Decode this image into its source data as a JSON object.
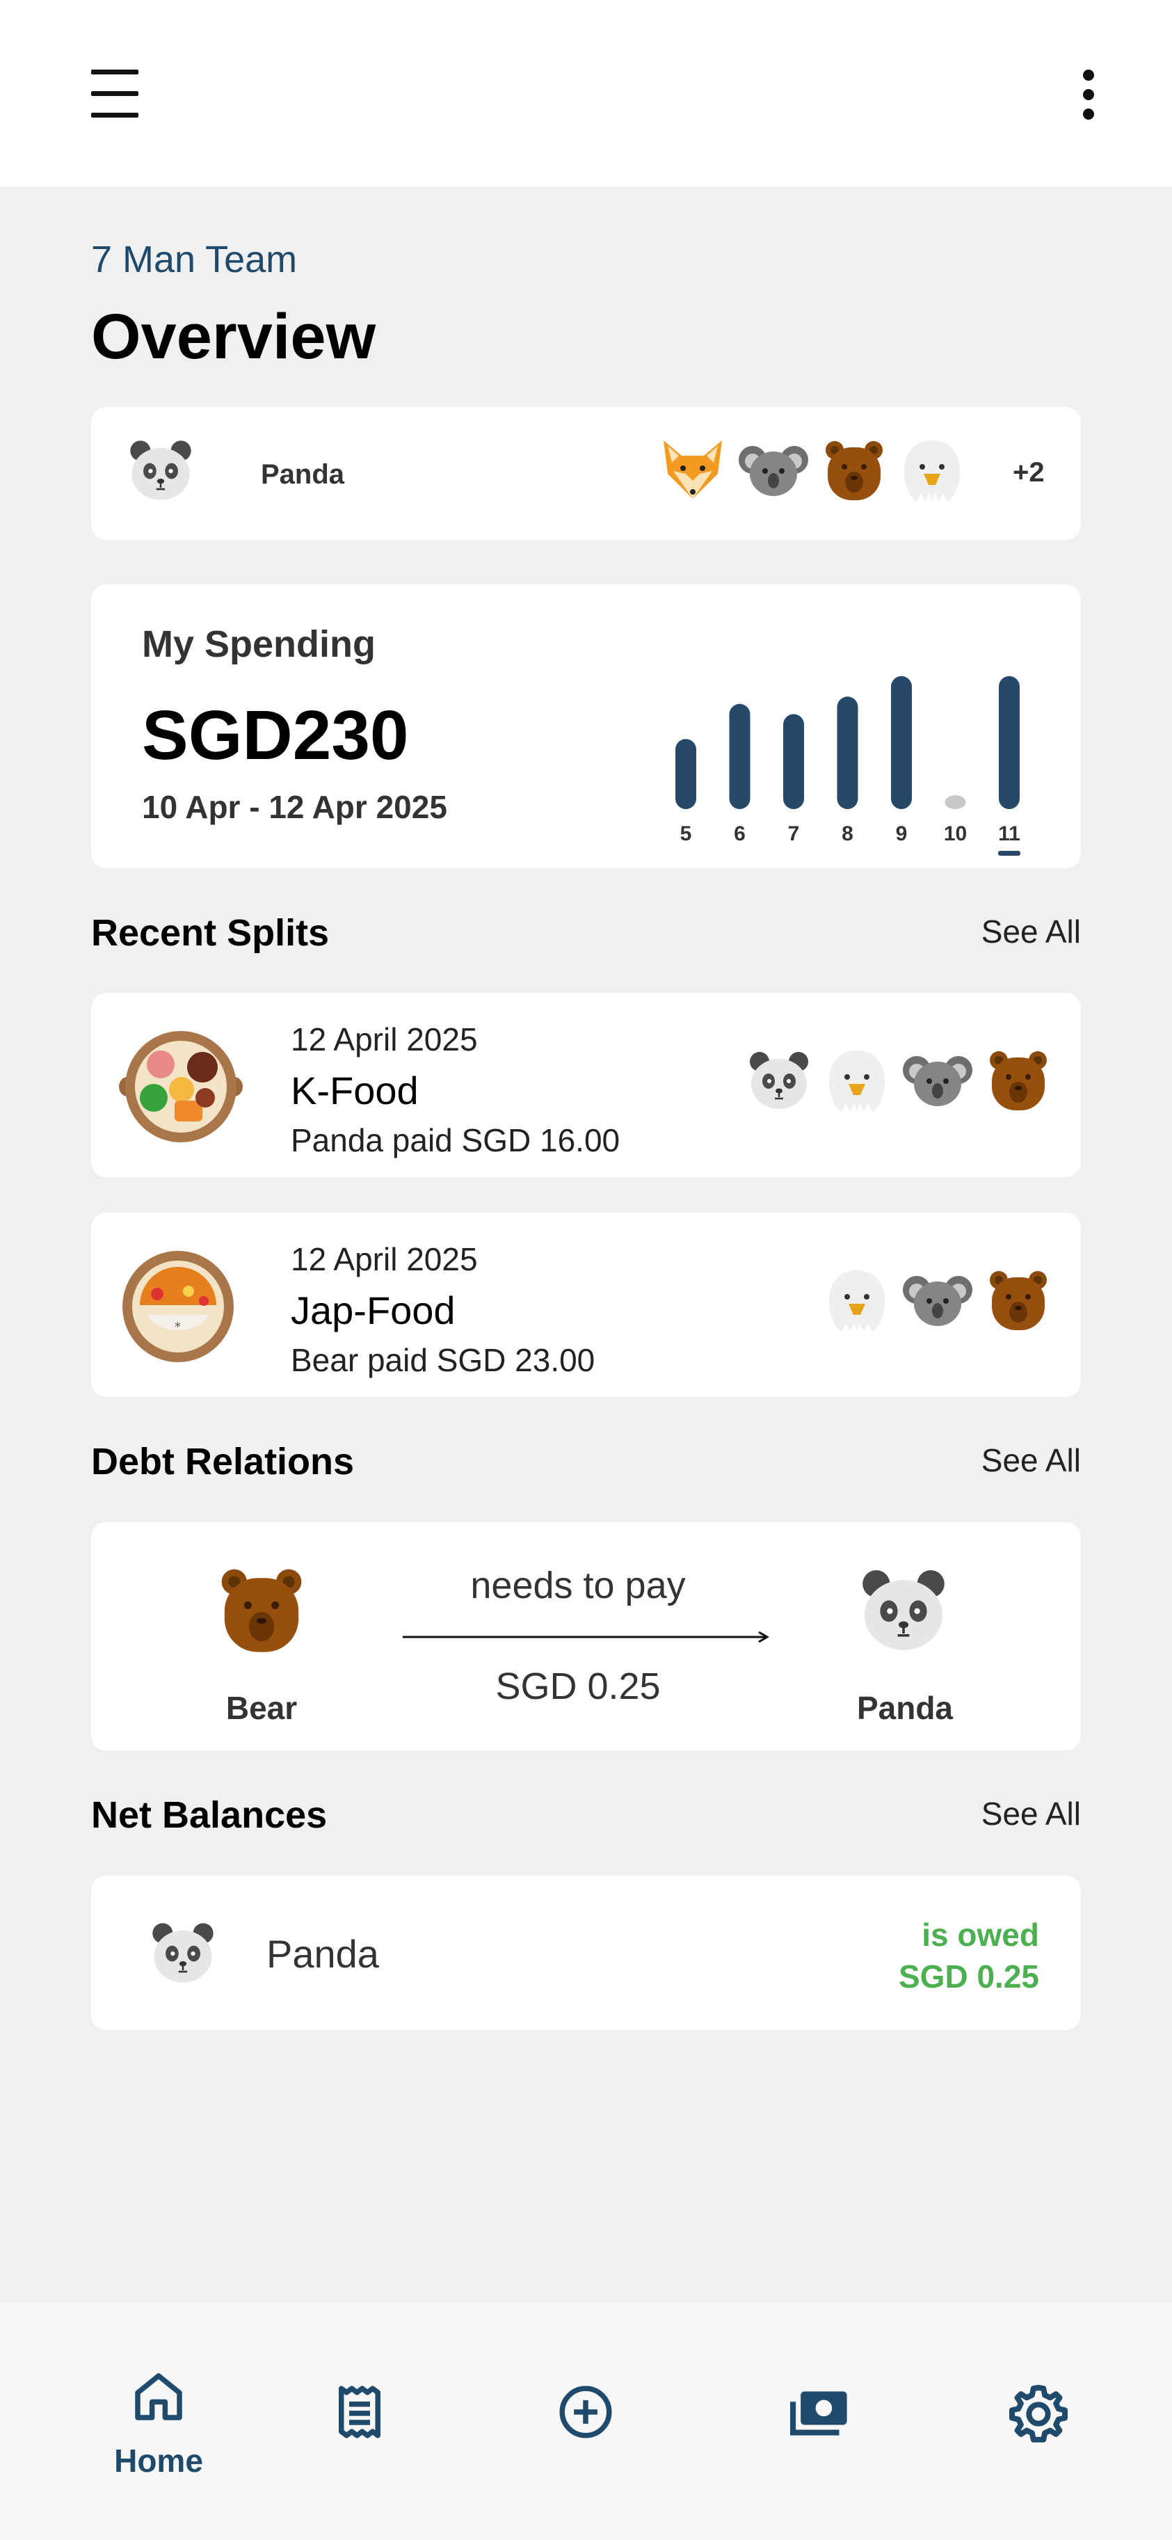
{
  "header": {
    "menu_icon": "hamburger-icon",
    "more_icon": "kebab-icon"
  },
  "group": {
    "name": "7 Man Team"
  },
  "page": {
    "title": "Overview"
  },
  "members": {
    "me": {
      "name": "Panda",
      "avatar": "panda-icon"
    },
    "others": [
      "fox-icon",
      "koala-icon",
      "bear-icon",
      "eagle-icon"
    ],
    "more_label": "+2"
  },
  "spending": {
    "label": "My Spending",
    "amount": "SGD230",
    "range": "10 Apr - 12 Apr 2025"
  },
  "chart_data": {
    "type": "bar",
    "categories": [
      "5",
      "6",
      "7",
      "8",
      "9",
      "10",
      "11"
    ],
    "values": [
      48,
      72,
      65,
      77,
      91,
      8,
      91
    ],
    "selected": "11",
    "colors": {
      "bar": "#26496a",
      "empty": "#c8c8c8"
    }
  },
  "recent_splits": {
    "title": "Recent Splits",
    "see_all": "See All",
    "items": [
      {
        "date": "12 April 2025",
        "name": "K-Food",
        "paid": "Panda paid SGD 16.00",
        "dish": "bibimbap-icon",
        "participants": [
          "panda-icon",
          "eagle-icon",
          "koala-icon",
          "bear-icon"
        ]
      },
      {
        "date": "12 April 2025",
        "name": "Jap-Food",
        "paid": "Bear paid SGD 23.00",
        "dish": "curry-rice-icon",
        "participants": [
          "eagle-icon",
          "koala-icon",
          "bear-icon"
        ]
      }
    ]
  },
  "debt_relations": {
    "title": "Debt Relations",
    "see_all": "See All",
    "from": "Bear",
    "verb": "needs to pay",
    "amount": "SGD 0.25",
    "to": "Panda"
  },
  "net_balances": {
    "title": "Net Balances",
    "see_all": "See All",
    "name": "Panda",
    "status": "is owed",
    "amount": "SGD 0.25",
    "status_color": "#4caf50"
  },
  "nav": {
    "home_label": "Home",
    "items": [
      "home-icon",
      "receipt-icon",
      "add-circle-icon",
      "cash-icon",
      "settings-icon"
    ]
  }
}
